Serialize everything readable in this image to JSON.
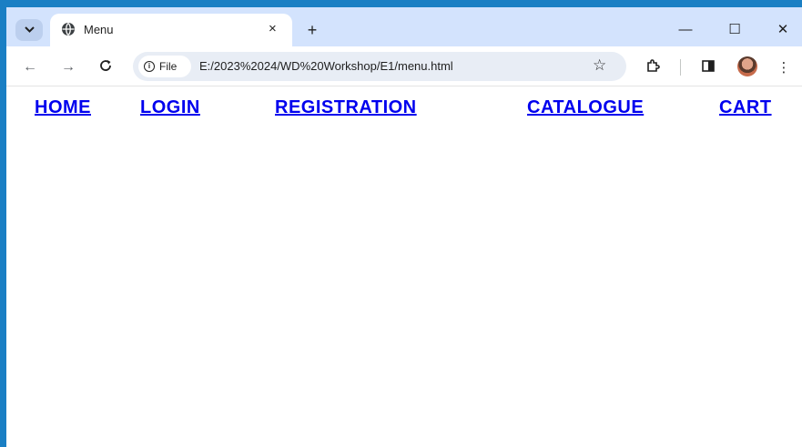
{
  "browser": {
    "tab_title": "Menu",
    "tab_close": "×",
    "new_tab": "+",
    "tab_search_icon": "chevron-down",
    "window_controls": {
      "minimize": "—",
      "maximize": "☐",
      "close": "✕"
    },
    "nav": {
      "back": "←",
      "forward": "→",
      "reload": "C"
    },
    "address": {
      "chip_label": "File",
      "url": "E:/2023%2024/WD%20Workshop/E1/menu.html"
    },
    "icons": {
      "bookmark": "☆",
      "extensions": "puzzle-icon",
      "side_panel": "side-panel-icon",
      "more": "⋮"
    }
  },
  "menu": {
    "items": [
      {
        "label": "HOME"
      },
      {
        "label": "LOGIN"
      },
      {
        "label": "REGISTRATION"
      },
      {
        "label": "CATALOGUE"
      },
      {
        "label": "CART"
      }
    ]
  },
  "colors": {
    "link": "#0000ee",
    "titlebar": "#d3e3fd",
    "window_border": "#1a7fc4"
  }
}
